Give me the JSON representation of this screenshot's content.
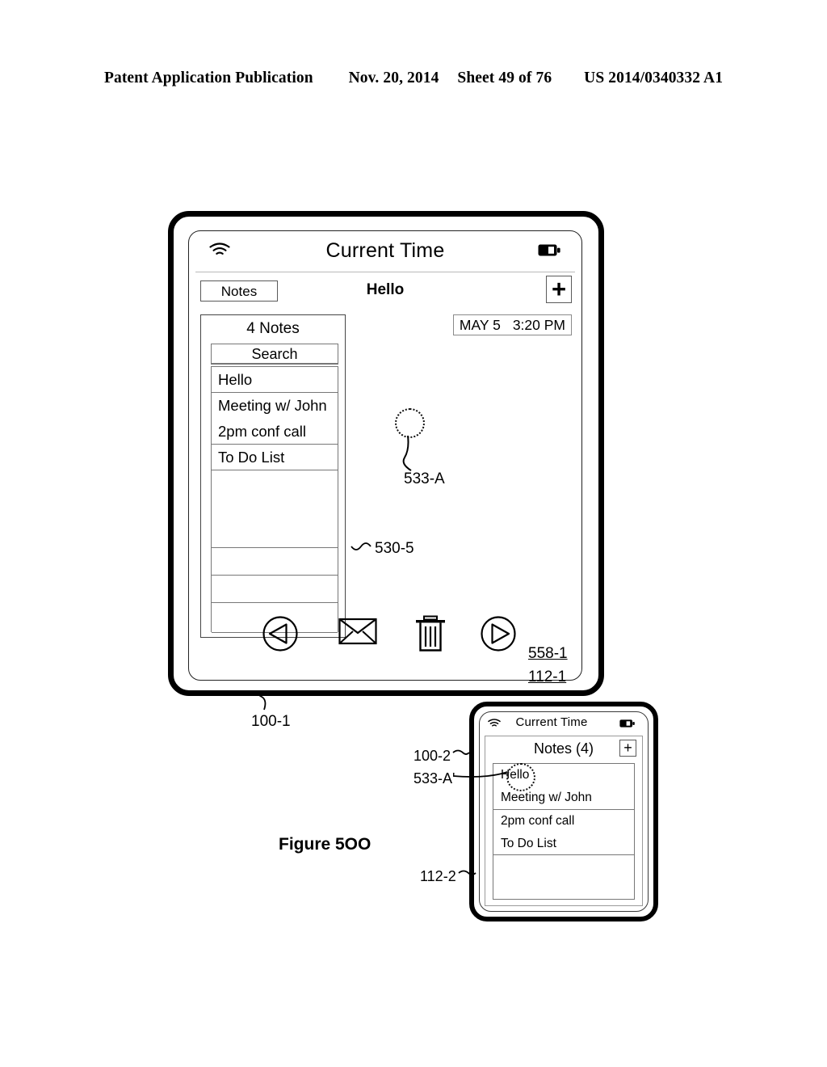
{
  "header": {
    "publication": "Patent Application Publication",
    "date": "Nov. 20, 2014",
    "sheet": "Sheet 49 of 76",
    "patent_number": "US 2014/0340332 A1"
  },
  "figure": {
    "caption": "Figure 5OO"
  },
  "tablet": {
    "ref": "100-1",
    "status_bar": {
      "title": "Current Time",
      "wifi_icon": "wifi-icon",
      "battery_icon": "battery-icon"
    },
    "nav_bar": {
      "back_label": "Notes",
      "doc_title": "Hello",
      "add_label": "+"
    },
    "date_badge": {
      "date": "MAY 5",
      "time": "3:20 PM"
    },
    "notes_panel": {
      "ref": "530-5",
      "title": "4 Notes",
      "search_placeholder": "Search",
      "cells": [
        {
          "lines": [
            "Hello"
          ],
          "height_class": "cell-h32"
        },
        {
          "lines": [
            "Meeting w/ John",
            "2pm conf call"
          ],
          "height_class": "cell-h64"
        },
        {
          "lines": [
            "To Do List"
          ],
          "height_class": "cell-h32"
        },
        {
          "lines": [],
          "height_class": "cell-h96"
        },
        {
          "lines": [],
          "height_class": "cell-h34"
        },
        {
          "lines": [],
          "height_class": "cell-h34"
        },
        {
          "lines": [],
          "height_class": "cell-h38"
        }
      ]
    },
    "toolbar": {
      "ref": "558-1",
      "items": [
        {
          "name": "previous-button",
          "icon": "circle-left-triangle-icon"
        },
        {
          "name": "mail-button",
          "icon": "envelope-icon"
        },
        {
          "name": "delete-button",
          "icon": "trash-icon"
        },
        {
          "name": "next-button",
          "icon": "circle-right-triangle-icon"
        }
      ]
    },
    "display_ref": "112-1",
    "touch_indicator": {
      "ref": "533-A"
    }
  },
  "phone": {
    "ref": "100-2",
    "status_bar": {
      "title": "Current Time",
      "wifi_icon": "wifi-icon",
      "battery_icon": "battery-icon"
    },
    "list_header": {
      "title": "Notes (4)",
      "add_label": "+"
    },
    "list_cells": [
      {
        "lines": [
          "Hello",
          "Meeting w/ John"
        ],
        "height_class": "cell-h56"
      },
      {
        "lines": [
          "2pm conf call",
          "To Do List"
        ],
        "height_class": "cell-h56"
      },
      {
        "lines": [],
        "height_class": "cell-h30"
      }
    ],
    "display_ref": "112-2",
    "touch_indicator": {
      "ref": "533-A'"
    }
  }
}
